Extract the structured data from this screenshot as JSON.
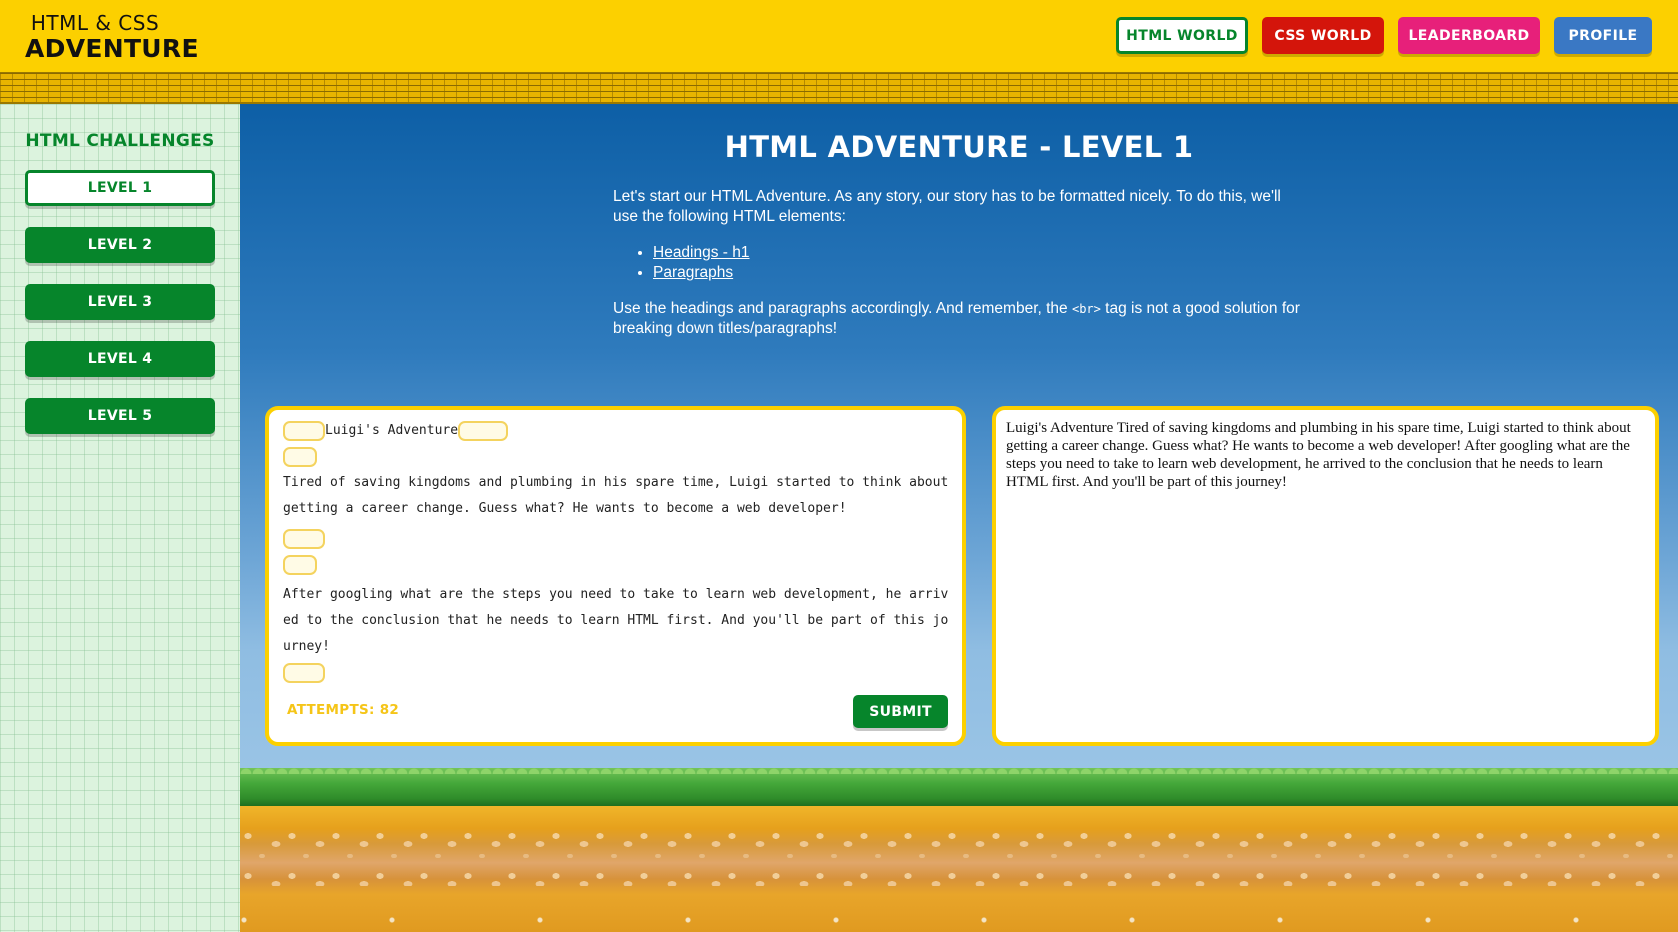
{
  "header": {
    "logo_top": "HTML & CSS",
    "logo_bottom": "ADVENTURE",
    "nav": {
      "html_world": "HTML WORLD",
      "css_world": "CSS WORLD",
      "leaderboard": "LEADERBOARD",
      "profile": "PROFILE"
    }
  },
  "colors": {
    "brand_yellow": "#fcd000",
    "green": "#06852b",
    "red": "#d4150b",
    "pink": "#e7207a",
    "blue": "#3a78c4"
  },
  "sidebar": {
    "title": "HTML CHALLENGES",
    "levels": [
      "LEVEL 1",
      "LEVEL 2",
      "LEVEL 3",
      "LEVEL 4",
      "LEVEL 5"
    ],
    "active_level": "LEVEL 1"
  },
  "main": {
    "title": "HTML ADVENTURE - LEVEL 1",
    "intro_p1": "Let's start our HTML Adventure. As any story, our story has to be formatted nicely. To do this, we'll use the following HTML elements:",
    "links": [
      "Headings - h1",
      "Paragraphs"
    ],
    "intro_p2_before": "Use the headings and paragraphs accordingly. And remember, the ",
    "intro_p2_code": "<br>",
    "intro_p2_after": " tag is not a good solution for breaking down titles/paragraphs!"
  },
  "editor": {
    "line1": "Luigi's Adventure",
    "para1": "Tired of saving kingdoms and plumbing in his spare time, Luigi started to think about getting a career change. Guess what? He wants to become a web developer!",
    "para2": "After googling what are the steps you need to take to learn web development, he arrived to the conclusion that he needs to learn HTML first. And you'll be part of this journey!",
    "attempts": "ATTEMPTS: 82",
    "submit": "SUBMIT"
  },
  "preview": {
    "text": "Luigi's Adventure Tired of saving kingdoms and plumbing in his spare time, Luigi started to think about getting a career change. Guess what? He wants to become a web developer! After googling what are the steps you need to take to learn web development, he arrived to the conclusion that he needs to learn HTML first. And you'll be part of this journey!"
  }
}
